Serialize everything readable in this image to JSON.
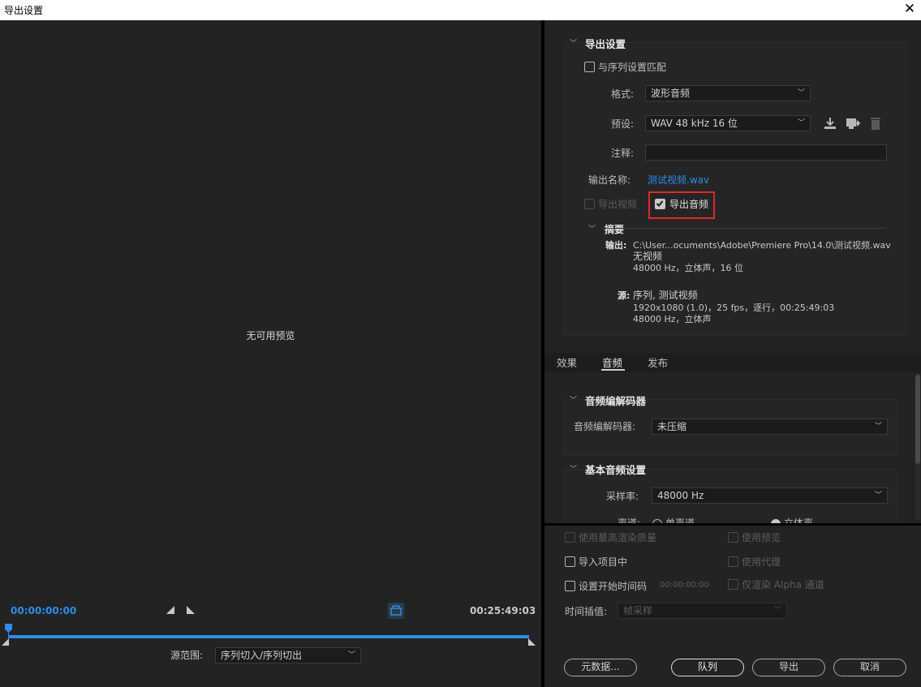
{
  "window": {
    "title": "导出设置"
  },
  "preview": {
    "no_preview_text": "无可用预览",
    "timecode_in": "00:00:00:00",
    "timecode_out": "00:25:49:03",
    "source_range_label": "源范围:",
    "source_range_value": "序列切入/序列切出"
  },
  "export_settings": {
    "section_title": "导出设置",
    "match_sequence_label": "与序列设置匹配",
    "match_sequence_checked": false,
    "format_label": "格式:",
    "format_value": "波形音频",
    "preset_label": "预设:",
    "preset_value": "WAV 48 kHz 16 位",
    "comments_label": "注释:",
    "comments_value": "",
    "output_name_label": "输出名称:",
    "output_name_value": "测试视频.wav",
    "export_video_label": "导出视频",
    "export_video_checked": false,
    "export_audio_label": "导出音频",
    "export_audio_checked": true,
    "summary": {
      "title": "摘要",
      "output_label": "输出:",
      "output_lines": [
        "C:\\User...ocuments\\Adobe\\Premiere Pro\\14.0\\测试视频.wav",
        "无视频",
        "48000 Hz，立体声，16 位"
      ],
      "source_label": "源:",
      "source_lines": [
        "序列, 测试视频",
        "1920x1080 (1.0)，25 fps，逐行，00:25:49:03",
        "48000 Hz，立体声"
      ]
    }
  },
  "tabs": [
    {
      "label": "效果",
      "active": false
    },
    {
      "label": "音频",
      "active": true
    },
    {
      "label": "发布",
      "active": false
    }
  ],
  "audio": {
    "codec_section_title": "音频编解码器",
    "codec_label": "音频编解码器:",
    "codec_value": "未压缩",
    "basic_section_title": "基本音频设置",
    "sample_rate_label": "采样率:",
    "sample_rate_value": "48000 Hz",
    "channels_label": "声道:",
    "channel_mono": "单声道",
    "channel_stereo": "立体声"
  },
  "options": {
    "max_render_quality": "使用最高渲染质量",
    "use_previews": "使用预览",
    "import_into_project": "导入项目中",
    "use_proxies": "使用代理",
    "set_start_timecode": "设置开始时间码",
    "start_timecode_value": "00:00:00:00",
    "render_alpha_only": "仅渲染 Alpha 通道",
    "time_interpolation_label": "时间插值:",
    "time_interpolation_value": "帧采样"
  },
  "buttons": {
    "metadata": "元数据...",
    "queue": "队列",
    "export": "导出",
    "cancel": "取消"
  },
  "colors": {
    "accent": "#2d8ceb",
    "highlight_box": "#e0282a",
    "background": "#232323"
  }
}
